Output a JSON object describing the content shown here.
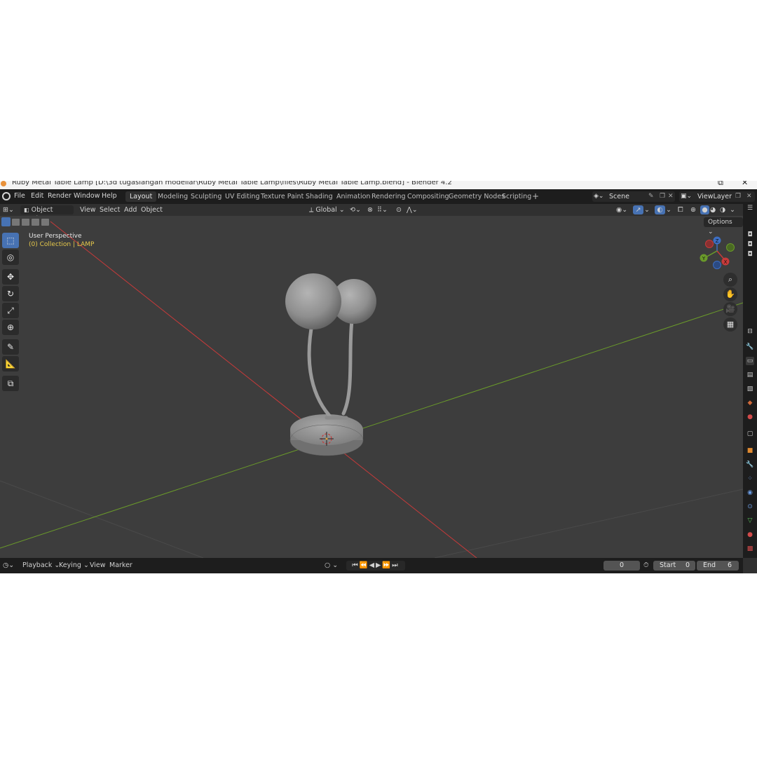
{
  "window": {
    "title": "Ruby Metal Table Lamp [D:\\3d tugaslangan modellar\\Ruby Metal Table Lamp\\files\\Ruby Metal Table Lamp.blend] - Blender 4.2",
    "maximize_glyph": "⧉",
    "close_glyph": "✕"
  },
  "menu": [
    "File",
    "Edit",
    "Render",
    "Window",
    "Help"
  ],
  "workspaces": {
    "tabs": [
      "Layout",
      "Modeling",
      "Sculpting",
      "UV Editing",
      "Texture Paint",
      "Shading",
      "Animation",
      "Rendering",
      "Compositing",
      "Geometry Nodes",
      "Scripting"
    ],
    "active": "Layout",
    "add_glyph": "+"
  },
  "scene": {
    "name": "Scene",
    "view_layer": "ViewLayer"
  },
  "header": {
    "mode": "Object Mode",
    "menus": [
      "View",
      "Select",
      "Add",
      "Object"
    ],
    "transform_orientation": "Global",
    "options_label": "Options"
  },
  "viewport": {
    "perspective_label": "User Perspective",
    "collection_label": "(0) Collection | LAMP"
  },
  "gizmo": {
    "z": "Z",
    "y": "Y",
    "x": "X"
  },
  "tools": [
    {
      "name": "select-box-tool",
      "glyph": "⬚",
      "active": true
    },
    {
      "name": "cursor-tool",
      "glyph": "◎",
      "active": false
    },
    {
      "name": "move-tool",
      "glyph": "✥",
      "active": false
    },
    {
      "name": "rotate-tool",
      "glyph": "↻",
      "active": false
    },
    {
      "name": "scale-tool",
      "glyph": "⤢",
      "active": false
    },
    {
      "name": "transform-tool",
      "glyph": "⊕",
      "active": false
    },
    {
      "name": "annotate-tool",
      "glyph": "✎",
      "active": false
    },
    {
      "name": "measure-tool",
      "glyph": "📐",
      "active": false
    },
    {
      "name": "add-cube-tool",
      "glyph": "⧉",
      "active": false
    }
  ],
  "nav_buttons": [
    {
      "name": "zoom-icon",
      "glyph": "⌕"
    },
    {
      "name": "pan-hand-icon",
      "glyph": "✋"
    },
    {
      "name": "camera-view-icon",
      "glyph": "🎥"
    },
    {
      "name": "ortho-grid-icon",
      "glyph": "▦"
    }
  ],
  "timeline": {
    "menus": [
      "Playback",
      "Keying",
      "View",
      "Marker"
    ],
    "current_frame": "0",
    "start_label": "Start",
    "start_value": "0",
    "end_label": "End",
    "end_value": "6"
  },
  "colors": {
    "x_axis": "#c83a3a",
    "y_axis": "#6a9a2a",
    "accent": "#4772b3",
    "lamp": "#9a9a9a"
  }
}
